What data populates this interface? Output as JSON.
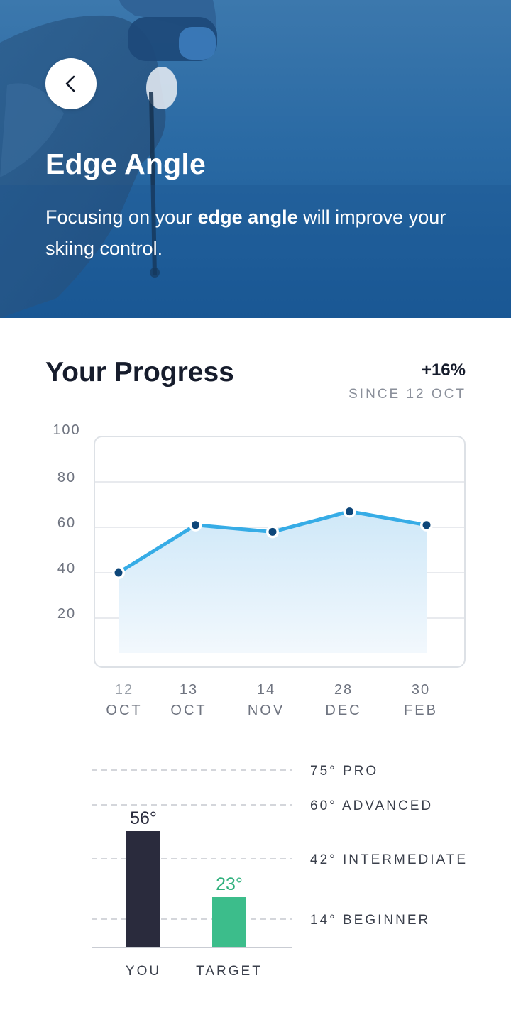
{
  "header": {
    "title": "Edge Angle",
    "description_pre": "Focusing on your ",
    "description_bold": "edge angle",
    "description_post": " will improve your skiing control."
  },
  "progress": {
    "title": "Your Progress",
    "delta": "+16%",
    "since": "SINCE 12 OCT"
  },
  "icons": {
    "back": "chevron-left-icon"
  },
  "colors": {
    "hero_blue": "#1a5a97",
    "line": "#36ace6",
    "point": "#0d4679",
    "you_bar": "#2a2b3d",
    "target_bar": "#3cbd8b",
    "target_text": "#2fb07c"
  },
  "chart_data": [
    {
      "type": "line",
      "x_line1": [
        "12",
        "13",
        "14",
        "28",
        "30"
      ],
      "x_line2": [
        "OCT",
        "OCT",
        "NOV",
        "DEC",
        "FEB"
      ],
      "values": [
        40,
        61,
        58,
        67,
        61
      ],
      "yticks": [
        "100",
        "80",
        "60",
        "40",
        "20"
      ],
      "ylim": [
        0,
        100
      ],
      "grid": true,
      "fill": "area"
    },
    {
      "type": "bar",
      "categories": [
        "YOU",
        "TARGET"
      ],
      "values": [
        56,
        23
      ],
      "value_labels": [
        "56°",
        "23°"
      ],
      "reference_lines": [
        {
          "value": 75,
          "label": "75° PRO"
        },
        {
          "value": 60,
          "label": "60° ADVANCED"
        },
        {
          "value": 42,
          "label": "42° INTERMEDIATE"
        },
        {
          "value": 14,
          "label": "14° BEGINNER"
        }
      ]
    }
  ]
}
